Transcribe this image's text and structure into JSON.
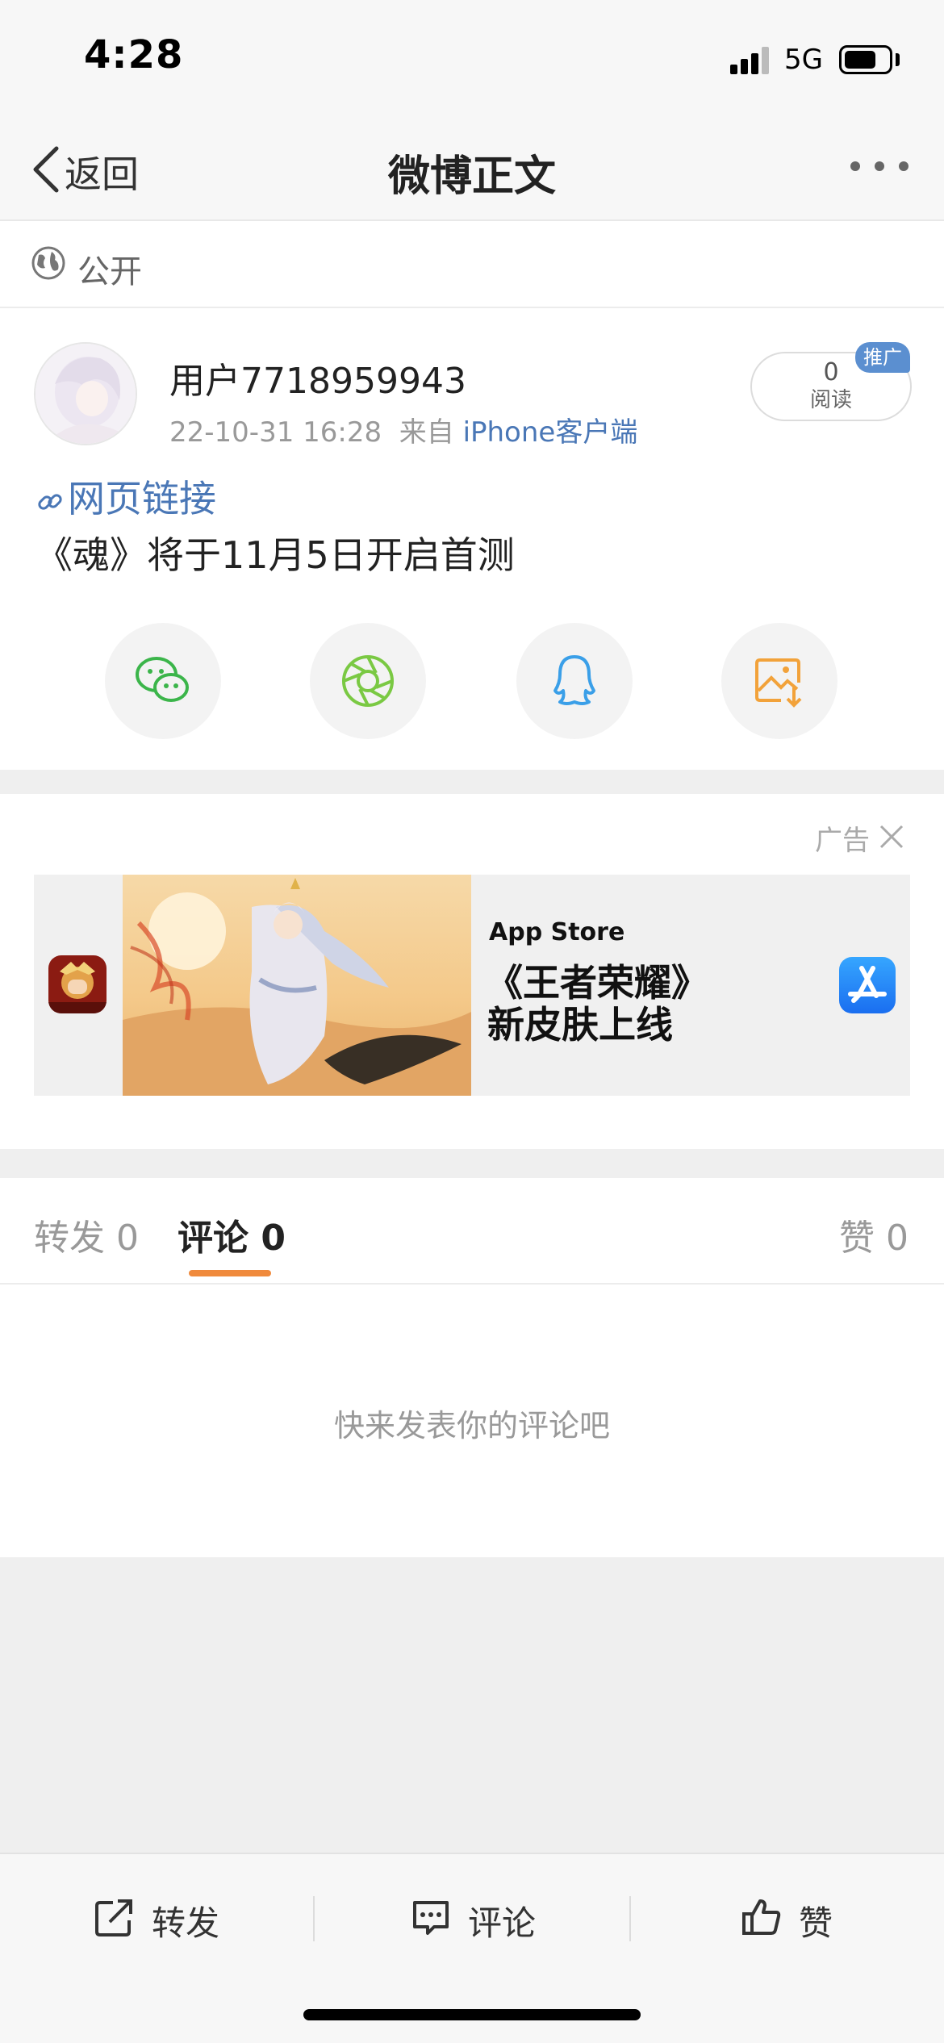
{
  "status_bar": {
    "time": "4:28",
    "network": "5G",
    "icons": [
      "signal-bars-icon",
      "battery-icon"
    ]
  },
  "nav": {
    "back_label": "返回",
    "title": "微博正文",
    "icons": [
      "chevron-left-icon",
      "more-dots-icon"
    ]
  },
  "visibility": {
    "label": "公开",
    "icon": "globe-icon"
  },
  "post": {
    "username": "用户7718959943",
    "timestamp": "22-10-31 16:28",
    "source_prefix": "来自",
    "source_client": "iPhone客户端",
    "reads_count": "0",
    "reads_label": "阅读",
    "promo_badge": "推广",
    "link_label": "网页链接",
    "text": "《魂》将于11月5日开启首测"
  },
  "share_buttons": [
    {
      "name": "wechat-icon",
      "color": "#3bb54a"
    },
    {
      "name": "moments-icon",
      "color": "#7ac943"
    },
    {
      "name": "qq-icon",
      "color": "#3a9fe8"
    },
    {
      "name": "save-image-icon",
      "color": "#f2a23a"
    }
  ],
  "ad": {
    "label": "广告",
    "store_name": "App Store",
    "title_line1": "《王者荣耀》",
    "title_line2": "新皮肤上线",
    "icons": [
      "close-icon",
      "game-app-icon",
      "app-store-icon"
    ]
  },
  "tabs": {
    "repost": "转发 0",
    "comment": "评论 0",
    "like": "赞 0",
    "active": "comment"
  },
  "comments": {
    "empty_text": "快来发表你的评论吧"
  },
  "toolbar": {
    "repost_label": "转发",
    "comment_label": "评论",
    "like_label": "赞"
  },
  "colors": {
    "accent_orange": "#f08a3c",
    "link_blue": "#4a77b6",
    "promo_blue": "#5b8fd0"
  }
}
